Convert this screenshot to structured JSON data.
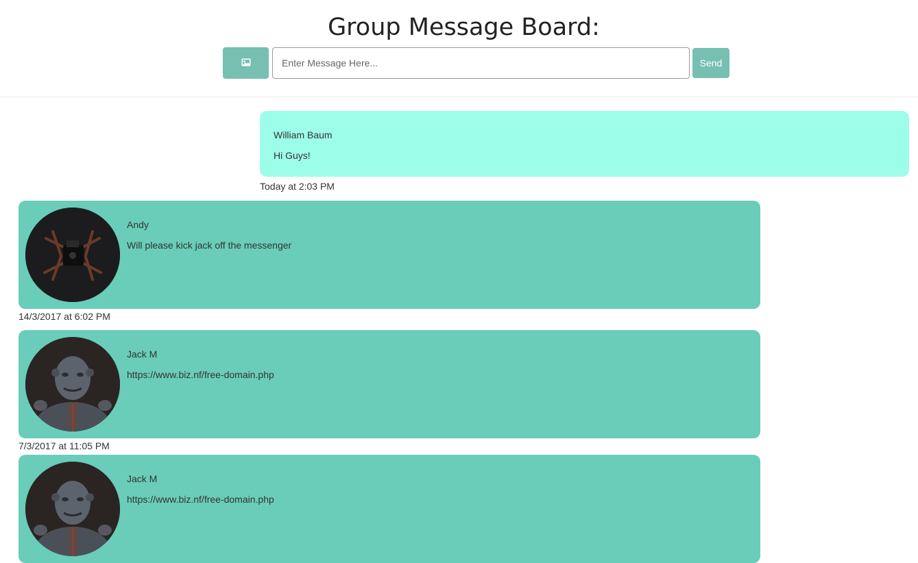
{
  "header": {
    "title": "Group Message Board:",
    "input_placeholder": "Enter Message Here...",
    "send_label": "Send",
    "image_button_icon": "image-icon"
  },
  "colors": {
    "accent": "#76bfb1",
    "own_bubble": "#9cfee9",
    "other_bubble": "#69cdb9"
  },
  "messages": [
    {
      "author": "William Baum",
      "text": "Hi Guys!",
      "timestamp": "Today at 2:03 PM",
      "own": true
    },
    {
      "author": "Andy",
      "text": "Will please kick jack off the messenger",
      "timestamp": "14/3/2017 at 6:02 PM",
      "avatar": "drone-avatar"
    },
    {
      "author": "Jack M",
      "text": "https://www.biz.nf/free-domain.php",
      "timestamp": "7/3/2017 at 11:05 PM",
      "avatar": "robot-avatar"
    },
    {
      "author": "Jack M",
      "text": "https://www.biz.nf/free-domain.php",
      "avatar": "robot-avatar"
    }
  ]
}
